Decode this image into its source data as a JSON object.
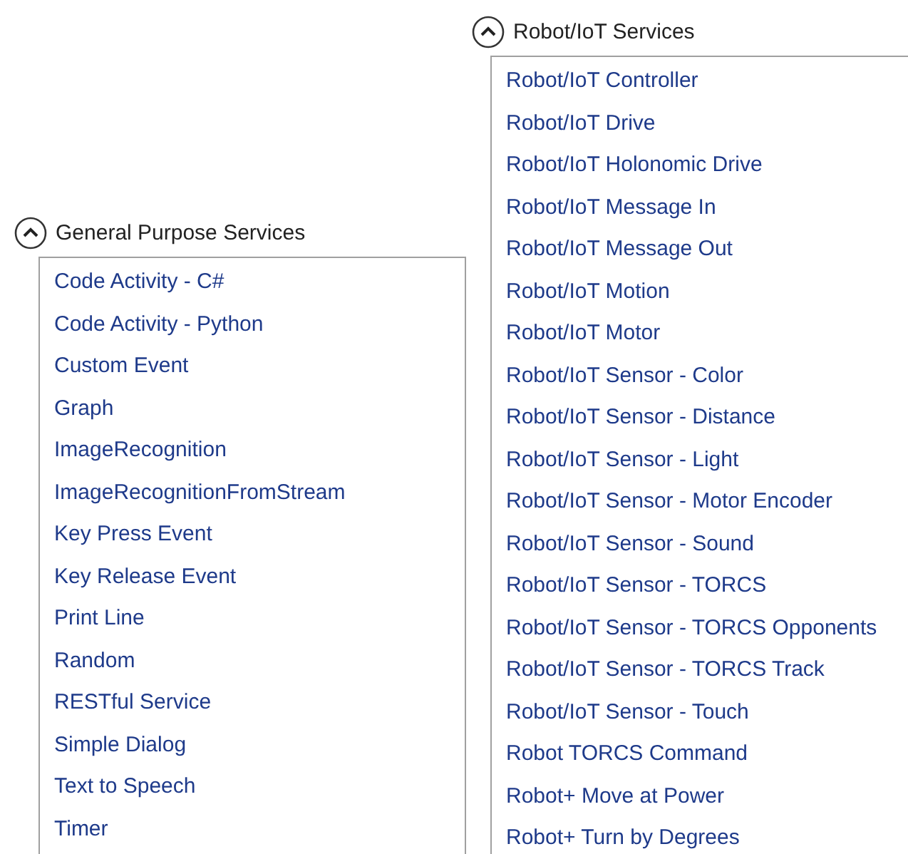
{
  "sections": [
    {
      "title": "General Purpose Services",
      "expanded": true,
      "items": [
        "Code Activity - C#",
        "Code Activity - Python",
        "Custom Event",
        "Graph",
        "ImageRecognition",
        "ImageRecognitionFromStream",
        "Key Press Event",
        "Key Release Event",
        "Print Line",
        "Random",
        "RESTful Service",
        "Simple Dialog",
        "Text to Speech",
        "Timer"
      ]
    },
    {
      "title": "Robot/IoT Services",
      "expanded": true,
      "items": [
        "Robot/IoT Controller",
        "Robot/IoT Drive",
        "Robot/IoT Holonomic Drive",
        "Robot/IoT Message In",
        "Robot/IoT Message Out",
        "Robot/IoT Motion",
        "Robot/IoT Motor",
        "Robot/IoT Sensor - Color",
        "Robot/IoT Sensor - Distance",
        "Robot/IoT Sensor - Light",
        "Robot/IoT Sensor - Motor Encoder",
        "Robot/IoT Sensor - Sound",
        "Robot/IoT Sensor - TORCS",
        "Robot/IoT Sensor - TORCS Opponents",
        "Robot/IoT Sensor - TORCS Track",
        "Robot/IoT Sensor - Touch",
        "Robot TORCS Command",
        "Robot+ Move at Power",
        "Robot+ Turn by Degrees"
      ]
    }
  ]
}
